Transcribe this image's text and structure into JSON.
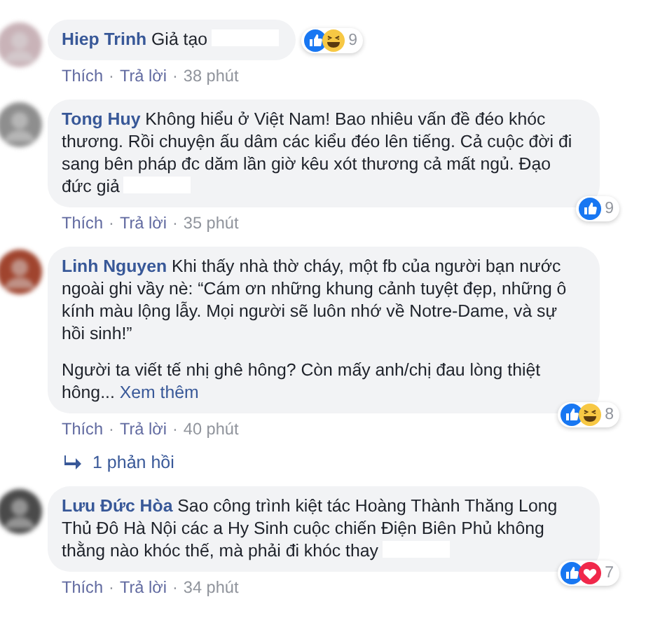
{
  "separator": "·",
  "comments": [
    {
      "author": "Hiep Trinh",
      "paragraphs": [
        "Giả tạo"
      ],
      "redacted": true,
      "reactions": [
        {
          "kind": "like"
        },
        {
          "kind": "haha"
        }
      ],
      "reaction_count": "9",
      "actions": [
        "Thích",
        "Trả lời"
      ],
      "time": "38 phút"
    },
    {
      "author": "Tong Huy",
      "paragraphs": [
        "Không hiểu ở Việt Nam! Bao nhiêu vấn đề đéo khóc thương. Rồi chuyện ấu dâm các kiểu đéo lên tiếng. Cả cuộc đời đi sang bên pháp đc dăm lần giờ kêu xót thương cả mất ngủ. Đạo đức giả"
      ],
      "redacted": true,
      "reactions": [
        {
          "kind": "like"
        }
      ],
      "reaction_count": "9",
      "actions": [
        "Thích",
        "Trả lời"
      ],
      "time": "35 phút"
    },
    {
      "author": "Linh Nguyen",
      "paragraphs": [
        "Khi thấy nhà thờ cháy, một fb của người bạn nước ngoài ghi vầy nè: “Cám ơn những khung cảnh tuyệt đẹp, những ô kính màu lộng lẫy. Mọi người sẽ luôn nhớ về Notre-Dame, và sự hồi sinh!”",
        "Người ta viết tế nhị ghê hông? Còn mấy anh/chị đau lòng thiệt hông..."
      ],
      "redacted": false,
      "see_more": "Xem thêm",
      "reactions": [
        {
          "kind": "like"
        },
        {
          "kind": "haha"
        }
      ],
      "reaction_count": "8",
      "actions": [
        "Thích",
        "Trả lời"
      ],
      "time": "40 phút",
      "replies": "1 phản hồi"
    },
    {
      "author": "Lưu Đức Hòa",
      "paragraphs": [
        "Sao công trình kiệt tác Hoàng Thành Thăng Long Thủ Đô Hà Nội các a Hy Sinh cuộc chiến Điện Biên Phủ không thằng nào khóc thế, mà phải đi khóc thay"
      ],
      "redacted": true,
      "reactions": [
        {
          "kind": "like"
        },
        {
          "kind": "love"
        }
      ],
      "reaction_count": "7",
      "actions": [
        "Thích",
        "Trả lời"
      ],
      "time": "34 phút"
    }
  ]
}
